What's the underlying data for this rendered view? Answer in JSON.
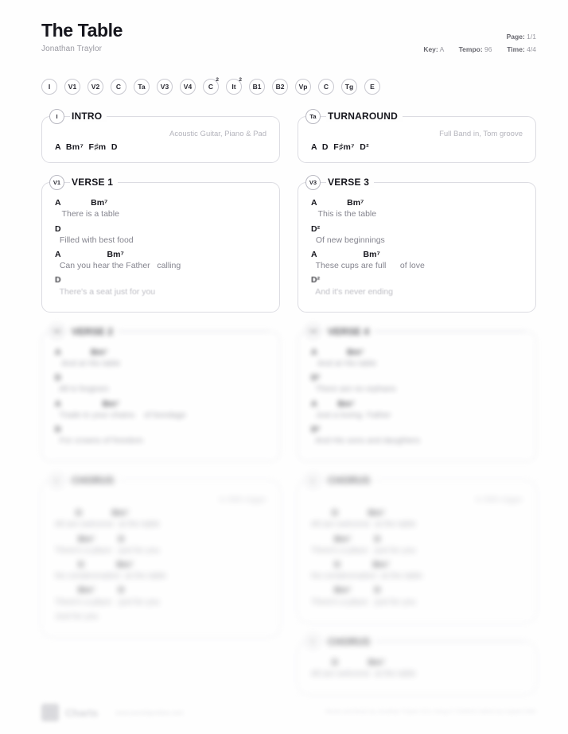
{
  "header": {
    "title": "The Table",
    "artist": "Jonathan Traylor",
    "page_label": "Page:",
    "page_value": "1/1",
    "key_label": "Key:",
    "key_value": "A",
    "tempo_label": "Tempo:",
    "tempo_value": "96",
    "time_label": "Time:",
    "time_value": "4/4"
  },
  "pills": [
    {
      "label": "I",
      "sup": ""
    },
    {
      "label": "V1",
      "sup": ""
    },
    {
      "label": "V2",
      "sup": ""
    },
    {
      "label": "C",
      "sup": ""
    },
    {
      "label": "Ta",
      "sup": ""
    },
    {
      "label": "V3",
      "sup": ""
    },
    {
      "label": "V4",
      "sup": ""
    },
    {
      "label": "C",
      "sup": "2"
    },
    {
      "label": "It",
      "sup": "2"
    },
    {
      "label": "B1",
      "sup": ""
    },
    {
      "label": "B2",
      "sup": ""
    },
    {
      "label": "Vp",
      "sup": ""
    },
    {
      "label": "C",
      "sup": ""
    },
    {
      "label": "Tg",
      "sup": ""
    },
    {
      "label": "E",
      "sup": ""
    }
  ],
  "left_column": {
    "intro": {
      "badge": "I",
      "name": "INTRO",
      "note": "Acoustic Guitar, Piano & Pad",
      "chords": "A  Bm⁷  F♯m  D"
    },
    "verse1": {
      "badge": "V1",
      "name": "VERSE 1",
      "lines": [
        {
          "chords": "A             Bm⁷",
          "lyric": "   There is a table"
        },
        {
          "chords": "D",
          "lyric": "  Filled with best food"
        },
        {
          "chords": "A                    Bm⁷",
          "lyric": "  Can you hear the Father   calling"
        },
        {
          "chords": "D",
          "lyric": "  There's a seat just for you"
        }
      ]
    },
    "verse2": {
      "badge": "V2",
      "name": "VERSE 2",
      "lines": [
        {
          "chords": "A             Bm⁷",
          "lyric": "   And at His table"
        },
        {
          "chords": "D",
          "lyric": "  All is forgiven"
        },
        {
          "chords": "A                  Bm⁷",
          "lyric": "  Trade in your chains    of bondage"
        },
        {
          "chords": "D",
          "lyric": "  For crowns of freedom"
        }
      ]
    },
    "chorus": {
      "badge": "C",
      "name": "CHORUS",
      "note": "In With trigger",
      "lines": [
        {
          "chords": "         D             Bm⁷",
          "lyric": "All are welcome  at the table"
        },
        {
          "chords": "          Bm⁷          D",
          "lyric": "There's a place   just for you"
        },
        {
          "chords": "          D              Bm⁷",
          "lyric": "No condemnation  at the table"
        },
        {
          "chords": "          Bm⁷          D",
          "lyric": "There's a place   just for you"
        },
        {
          "chords": "",
          "lyric": "Just for you"
        }
      ]
    }
  },
  "right_column": {
    "turnaround": {
      "badge": "Ta",
      "name": "TURNAROUND",
      "note": "Full Band in, Tom groove",
      "chords": "A  D  F♯m⁷  D²"
    },
    "verse3": {
      "badge": "V3",
      "name": "VERSE 3",
      "lines": [
        {
          "chords": "A             Bm⁷",
          "lyric": "   This is the table"
        },
        {
          "chords": "D²",
          "lyric": "  Of new beginnings"
        },
        {
          "chords": "A                    Bm⁷",
          "lyric": "  These cups are full      of love"
        },
        {
          "chords": "D²",
          "lyric": "  And it's never ending"
        }
      ]
    },
    "verse4": {
      "badge": "V4",
      "name": "VERSE 4",
      "lines": [
        {
          "chords": "A             Bm⁷",
          "lyric": "   And at His table"
        },
        {
          "chords": "D²",
          "lyric": "  There are no orphans"
        },
        {
          "chords": "A         Bm⁷",
          "lyric": "  Just a loving  Father"
        },
        {
          "chords": "D²",
          "lyric": "  And His sons and daughters"
        }
      ]
    },
    "chorus1": {
      "badge": "C",
      "name": "CHORUS",
      "note": "In With trigger",
      "lines": [
        {
          "chords": "         D             Bm⁷",
          "lyric": "All are welcome  at the table"
        },
        {
          "chords": "          Bm⁷          D",
          "lyric": "There's a place   just for you"
        },
        {
          "chords": "          D              Bm⁷",
          "lyric": "No condemnation  at the table"
        },
        {
          "chords": "          Bm⁷          D",
          "lyric": "There's a place   just for you"
        }
      ]
    },
    "chorus2": {
      "badge": "C",
      "name": "CHORUS",
      "lines": [
        {
          "chords": "         D             Bm⁷",
          "lyric": "All are welcome  at the table"
        }
      ]
    }
  },
  "footer": {
    "brand": "Charts",
    "url": "www.worshiponline.com",
    "credit": "Words and Music by Jonathan Traylor\nCCLI Song # 7154533 | Admin by Capitol CMG"
  }
}
